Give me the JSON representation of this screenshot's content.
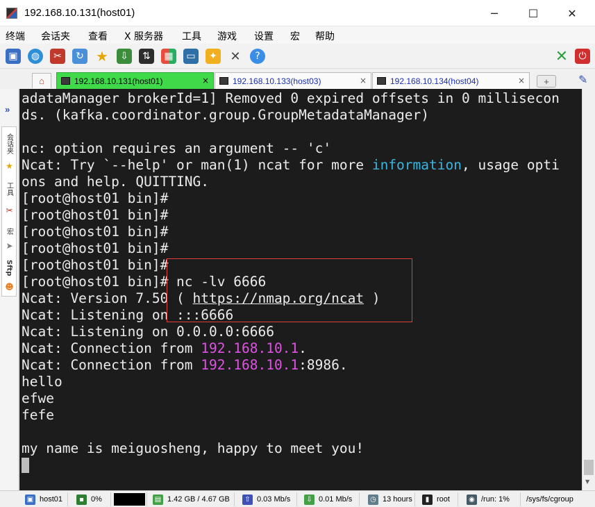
{
  "window": {
    "title": "192.168.10.131(host01)",
    "minimize": "─",
    "maximize": "☐",
    "close": "✕"
  },
  "menu": [
    "终端",
    "会话夹",
    "查看",
    "X 服务器",
    "工具",
    "游戏",
    "设置",
    "宏",
    "帮助"
  ],
  "toolbar": {
    "icons": [
      "new-session-icon",
      "globe-icon",
      "disconnect-icon",
      "reconnect-icon",
      "favorites-star-icon",
      "download-icon",
      "transfer-icon",
      "tiles-icon",
      "monitor-icon",
      "multi-exec-icon",
      "tools-icon",
      "help-icon"
    ],
    "right_icons": [
      "x-server-icon",
      "power-icon"
    ]
  },
  "tabs": [
    {
      "label": "192.168.10.131(host01)",
      "active": true,
      "close": "×"
    },
    {
      "label": "192.168.10.133(host03)",
      "active": false,
      "close": "×"
    },
    {
      "label": "192.168.10.134(host04)",
      "active": false,
      "close": "×"
    }
  ],
  "side_panel": {
    "expand": "»",
    "tabs": [
      "会话夹",
      "工具",
      "宏",
      "Sftp"
    ]
  },
  "terminal": {
    "lines": [
      [
        {
          "t": "adataManager brokerId=1] Removed 0 expired offsets in 0 millisecon"
        }
      ],
      [
        {
          "t": "ds. (kafka.coordinator.group.GroupMetadataManager)"
        }
      ],
      [
        {
          "t": ""
        }
      ],
      [
        {
          "t": "nc: option requires an argument -- 'c'"
        }
      ],
      [
        {
          "t": "Ncat: Try `--help' or man(1) ncat for more "
        },
        {
          "t": "information",
          "c": "cyan"
        },
        {
          "t": ", usage opti"
        }
      ],
      [
        {
          "t": "ons and help. QUITTING."
        }
      ],
      [
        {
          "t": "[root@host01 bin]#"
        }
      ],
      [
        {
          "t": "[root@host01 bin]#"
        }
      ],
      [
        {
          "t": "[root@host01 bin]#"
        }
      ],
      [
        {
          "t": "[root@host01 bin]#"
        }
      ],
      [
        {
          "t": "[root@host01 bin]#"
        }
      ],
      [
        {
          "t": "[root@host01 bin]# nc -lv 6666"
        }
      ],
      [
        {
          "t": "Ncat: Version 7.50 ( "
        },
        {
          "t": "https://nmap.org/ncat",
          "c": "underline"
        },
        {
          "t": " )"
        }
      ],
      [
        {
          "t": "Ncat: Listening on :::6666"
        }
      ],
      [
        {
          "t": "Ncat: Listening on 0.0.0.0:6666"
        }
      ],
      [
        {
          "t": "Ncat: Connection from "
        },
        {
          "t": "192.168.10.1",
          "c": "magenta"
        },
        {
          "t": "."
        }
      ],
      [
        {
          "t": "Ncat: Connection from "
        },
        {
          "t": "192.168.10.1",
          "c": "magenta"
        },
        {
          "t": ":8986."
        }
      ],
      [
        {
          "t": "hello"
        }
      ],
      [
        {
          "t": "efwe"
        }
      ],
      [
        {
          "t": "fefe"
        }
      ],
      [
        {
          "t": ""
        }
      ],
      [
        {
          "t": "my name is meiguosheng, happy to meet you!"
        }
      ],
      [
        {
          "t": "",
          "cursor": true
        }
      ]
    ]
  },
  "statusbar": {
    "host": "host01",
    "cpu": "0%",
    "memory": "1.42 GB / 4.67 GB",
    "upload": "0.03 Mb/s",
    "download": "0.01 Mb/s",
    "uptime": "13 hours",
    "user": "root",
    "disk": "/run: 1%",
    "path": "/sys/fs/cgroup"
  },
  "colors": {
    "terminal_bg": "#1c1c1c",
    "terminal_fg": "#ececec",
    "cyan": "#39b6e0",
    "magenta": "#e052e6",
    "active_tab": "#3fd94a",
    "selection_box": "#e0403a"
  }
}
